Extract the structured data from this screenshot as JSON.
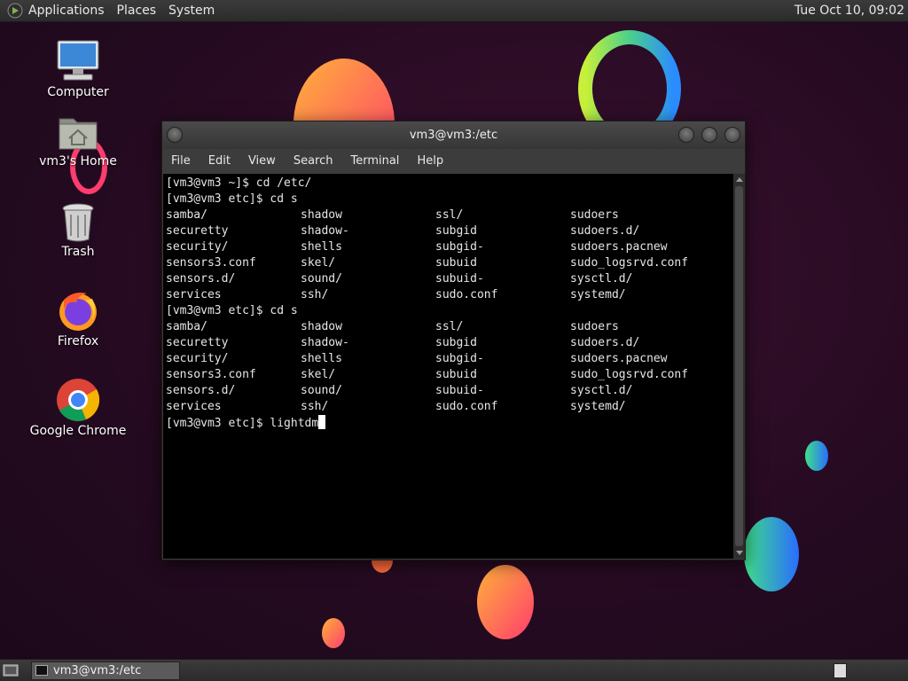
{
  "top_panel": {
    "menus": [
      "Applications",
      "Places",
      "System"
    ],
    "clock": "Tue Oct 10, 09:02"
  },
  "desktop_icons": [
    {
      "label": "Computer",
      "icon": "computer-icon"
    },
    {
      "label": "vm3's Home",
      "icon": "home-folder-icon"
    },
    {
      "label": "Trash",
      "icon": "trash-icon"
    },
    {
      "label": "Firefox",
      "icon": "firefox-icon"
    },
    {
      "label": "Google Chrome",
      "icon": "chrome-icon"
    }
  ],
  "terminal": {
    "title": "vm3@vm3:/etc",
    "menus": [
      "File",
      "Edit",
      "View",
      "Search",
      "Terminal",
      "Help"
    ],
    "lines": [
      {
        "type": "prompt",
        "text": "[vm3@vm3 ~]$ cd /etc/"
      },
      {
        "type": "prompt",
        "text": "[vm3@vm3 etc]$ cd s"
      },
      {
        "type": "cols",
        "cols": [
          "samba/",
          "shadow",
          "ssl/",
          "sudoers"
        ]
      },
      {
        "type": "cols",
        "cols": [
          "securetty",
          "shadow-",
          "subgid",
          "sudoers.d/"
        ]
      },
      {
        "type": "cols",
        "cols": [
          "security/",
          "shells",
          "subgid-",
          "sudoers.pacnew"
        ]
      },
      {
        "type": "cols",
        "cols": [
          "sensors3.conf",
          "skel/",
          "subuid",
          "sudo_logsrvd.conf"
        ]
      },
      {
        "type": "cols",
        "cols": [
          "sensors.d/",
          "sound/",
          "subuid-",
          "sysctl.d/"
        ]
      },
      {
        "type": "cols",
        "cols": [
          "services",
          "ssh/",
          "sudo.conf",
          "systemd/"
        ]
      },
      {
        "type": "prompt",
        "text": "[vm3@vm3 etc]$ cd s"
      },
      {
        "type": "cols",
        "cols": [
          "samba/",
          "shadow",
          "ssl/",
          "sudoers"
        ]
      },
      {
        "type": "cols",
        "cols": [
          "securetty",
          "shadow-",
          "subgid",
          "sudoers.d/"
        ]
      },
      {
        "type": "cols",
        "cols": [
          "security/",
          "shells",
          "subgid-",
          "sudoers.pacnew"
        ]
      },
      {
        "type": "cols",
        "cols": [
          "sensors3.conf",
          "skel/",
          "subuid",
          "sudo_logsrvd.conf"
        ]
      },
      {
        "type": "cols",
        "cols": [
          "sensors.d/",
          "sound/",
          "subuid-",
          "sysctl.d/"
        ]
      },
      {
        "type": "cols",
        "cols": [
          "services",
          "ssh/",
          "sudo.conf",
          "systemd/"
        ]
      },
      {
        "type": "input",
        "text": "[vm3@vm3 etc]$ lightdm"
      }
    ]
  },
  "taskbar": {
    "task_label": "vm3@vm3:/etc"
  }
}
